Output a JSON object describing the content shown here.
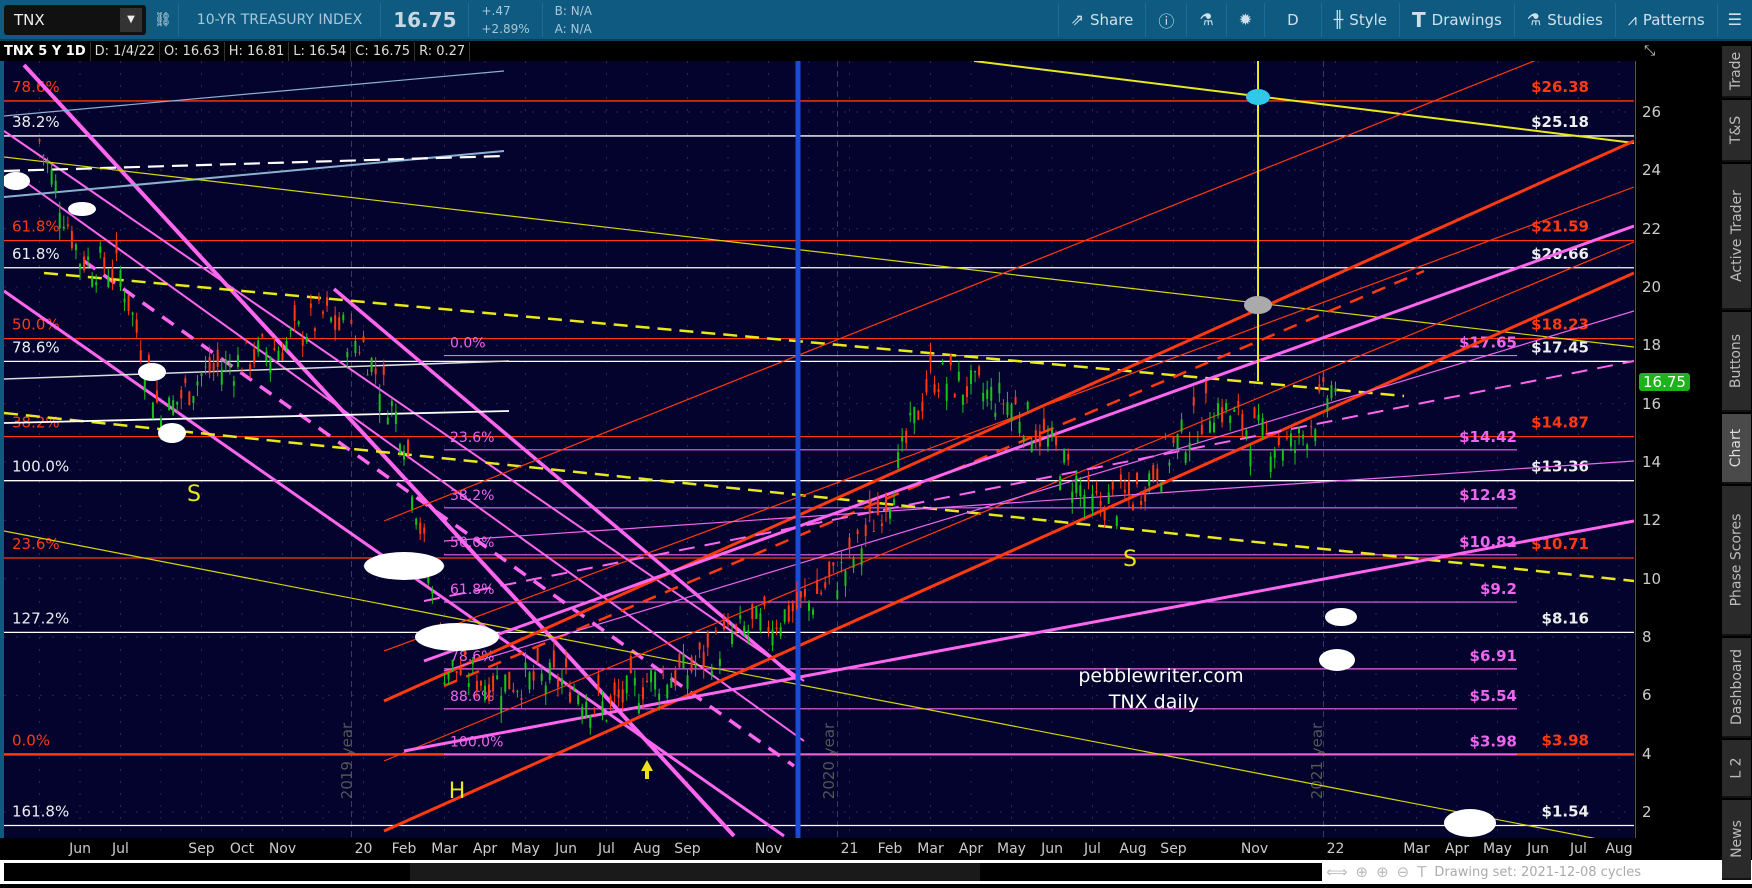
{
  "toolbar": {
    "symbol": "TNX",
    "description": "10-YR TREASURY INDEX",
    "last": "16.75",
    "change": "+.47",
    "change_pct": "+2.89%",
    "bid": "B: N/A",
    "ask": "A: N/A",
    "buttons": {
      "share": "Share",
      "timeframe": "D",
      "style": "Style",
      "drawings": "Drawings",
      "studies": "Studies",
      "patterns": "Patterns"
    }
  },
  "info": {
    "symbol": "TNX 5 Y 1D",
    "date": "D: 1/4/22",
    "open": "O: 16.63",
    "high": "H: 16.81",
    "low": "L: 16.54",
    "close": "C: 16.75",
    "range": "R: 0.27"
  },
  "price_axis": {
    "ticks": [
      "26",
      "24",
      "22",
      "20",
      "18",
      "16",
      "14",
      "12",
      "10",
      "8",
      "6",
      "4",
      "2"
    ],
    "current": "16.75",
    "current_color": "#1bb41b"
  },
  "date_axis": [
    "Jun",
    "Jul",
    "Sep",
    "Oct",
    "Nov",
    "20",
    "Feb",
    "Mar",
    "Apr",
    "May",
    "Jun",
    "Jul",
    "Aug",
    "Sep",
    "Nov",
    "21",
    "Feb",
    "Mar",
    "Apr",
    "May",
    "Jun",
    "Jul",
    "Aug",
    "Sep",
    "Nov",
    "22",
    "Mar",
    "Apr",
    "May",
    "Jun",
    "Jul",
    "Aug"
  ],
  "fib_left": [
    {
      "pct": "78.6%",
      "price": "$26.38",
      "value": 26.38,
      "color": "#ff3a10"
    },
    {
      "pct": "38.2%",
      "price": "$25.18",
      "value": 25.18,
      "color": "#ffffff"
    },
    {
      "pct": "61.8%",
      "price": "$21.59",
      "value": 21.59,
      "color": "#ff3a10"
    },
    {
      "pct": "61.8%",
      "price": "$20.66",
      "value": 20.66,
      "color": "#ffffff"
    },
    {
      "pct": "50.0%",
      "price": "$18.23",
      "value": 18.23,
      "color": "#ff3a10"
    },
    {
      "pct": "78.6%",
      "price": "$17.45",
      "value": 17.45,
      "color": "#ffffff"
    },
    {
      "pct": "38.2%",
      "price": "$14.87",
      "value": 14.87,
      "color": "#ff3a10"
    },
    {
      "pct": "100.0%",
      "price": "$13.36",
      "value": 13.36,
      "color": "#ffffff"
    },
    {
      "pct": "23.6%",
      "price": "$10.71",
      "value": 10.71,
      "color": "#ff3a10"
    },
    {
      "pct": "127.2%",
      "price": "$8.16",
      "value": 8.16,
      "color": "#ffffff"
    },
    {
      "pct": "0.0%",
      "price": "$3.98",
      "value": 3.98,
      "color": "#ff3a10"
    },
    {
      "pct": "161.8%",
      "price": "$1.54",
      "value": 1.54,
      "color": "#ffffff"
    }
  ],
  "fib_mid": [
    {
      "pct": "0.0%",
      "price": "$17.65",
      "value": 17.65
    },
    {
      "pct": "23.6%",
      "price": "$14.42",
      "value": 14.42
    },
    {
      "pct": "38.2%",
      "price": "$12.43",
      "value": 12.43
    },
    {
      "pct": "50.0%",
      "price": "$10.82",
      "value": 10.82
    },
    {
      "pct": "61.8%",
      "price": "$9.2",
      "value": 9.2
    },
    {
      "pct": "78.6%",
      "price": "$6.91",
      "value": 6.91
    },
    {
      "pct": "88.6%",
      "price": "$5.54",
      "value": 5.54
    },
    {
      "pct": "100.0%",
      "price": "$3.98",
      "value": 3.98
    }
  ],
  "annotations": {
    "watermark1": "pebblewriter.com",
    "watermark2": "TNX daily",
    "s1": "S",
    "s2": "S",
    "h": "H",
    "year2019": "2019 year",
    "year2020": "2020 year",
    "year2021": "2021 year"
  },
  "price_series": {
    "start": "May 2019",
    "step": "month",
    "closes": [
      25,
      21,
      20.5,
      15.5,
      17,
      17.5,
      18,
      19,
      18,
      15,
      7,
      6.5,
      6.5,
      6.5,
      5.5,
      6.5,
      6.8,
      8,
      8.5,
      9.2,
      10.5,
      13,
      17,
      16.5,
      16,
      14.5,
      12.5,
      12.8,
      14.5,
      16,
      15,
      14.5,
      16.75
    ]
  },
  "colors": {
    "up": "#19c219",
    "down": "#ff3a10",
    "fib_mid": "#ee66ee",
    "background": "#03032e"
  },
  "bottom": {
    "drawing_set": "Drawing set: 2021-12-08 cycles"
  },
  "sidebar": [
    "Trade",
    "T&S",
    "Active Trader",
    "Buttons",
    "Chart",
    "Phase Scores",
    "Dashboard",
    "L 2",
    "News"
  ]
}
